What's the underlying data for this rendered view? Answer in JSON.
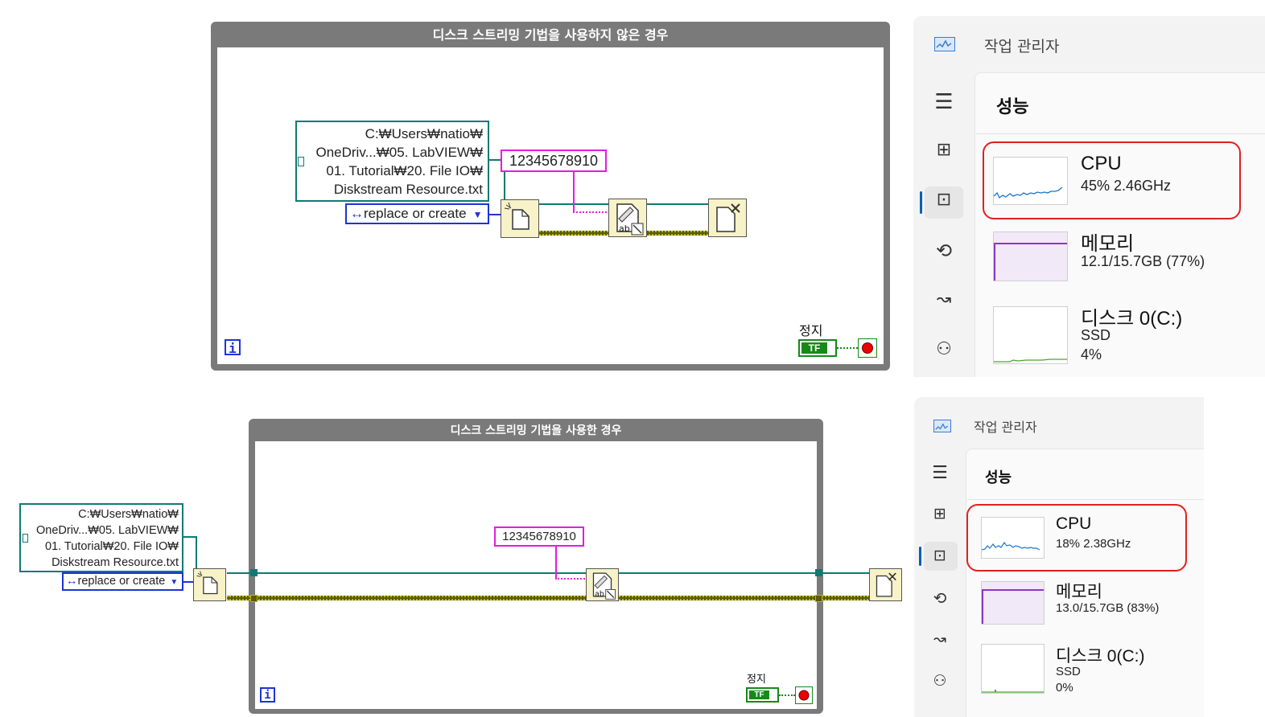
{
  "top": {
    "loop_title": "디스크 스트리밍 기법을 사용하지 않은 경우",
    "path_lines": [
      "C:₩Users₩natio₩",
      "OneDriv...₩05. LabVIEW₩",
      "01. Tutorial₩20. File IO₩",
      "Diskstream Resource.txt"
    ],
    "enum_value": "replace or create",
    "string_value": "12345678910",
    "stop_label": "정지",
    "tf_label": "TF",
    "iteration_label": "i"
  },
  "bottom": {
    "loop_title": "디스크 스트리밍 기법을 사용한 경우",
    "path_lines": [
      "C:₩Users₩natio₩",
      "OneDriv...₩05. LabVIEW₩",
      "01. Tutorial₩20. File IO₩",
      "Diskstream Resource.txt"
    ],
    "enum_value": "replace or create",
    "string_value": "12345678910",
    "stop_label": "정지",
    "tf_label": "TF",
    "iteration_label": "i"
  },
  "tm_top": {
    "app_title": "작업 관리자",
    "section_title": "성능",
    "cpu": {
      "name": "CPU",
      "detail": "45%  2.46GHz",
      "usage_percent": 45
    },
    "memory": {
      "name": "메모리",
      "detail": "12.1/15.7GB (77%)",
      "usage_percent": 77
    },
    "disk": {
      "name": "디스크 0(C:)",
      "type": "SSD",
      "detail": "4%",
      "usage_percent": 4
    }
  },
  "tm_bottom": {
    "app_title": "작업 관리자",
    "section_title": "성능",
    "cpu": {
      "name": "CPU",
      "detail": "18%  2.38GHz",
      "usage_percent": 18
    },
    "memory": {
      "name": "메모리",
      "detail": "13.0/15.7GB (83%)",
      "usage_percent": 83
    },
    "disk": {
      "name": "디스크 0(C:)",
      "type": "SSD",
      "detail": "0%",
      "usage_percent": 0
    }
  },
  "colors": {
    "loop_frame": "#7a7a7a",
    "path_wire": "#0e7a73",
    "string_wire": "#e21ce2",
    "error_wire": "#b8b800",
    "enum_border": "#1f33d6",
    "boolean": "#158a17",
    "cpu_graph": "#1a77c9",
    "memory_graph": "#8a37c6",
    "disk_graph": "#4aa52e",
    "highlight": "#e02020"
  },
  "icons": {
    "app": "task-manager-icon",
    "nav": [
      "hamburger-menu-icon",
      "processes-icon",
      "performance-icon",
      "app-history-icon",
      "startup-apps-icon",
      "users-icon"
    ],
    "nodes": [
      "open-file-icon",
      "write-text-file-icon",
      "close-file-icon"
    ]
  }
}
